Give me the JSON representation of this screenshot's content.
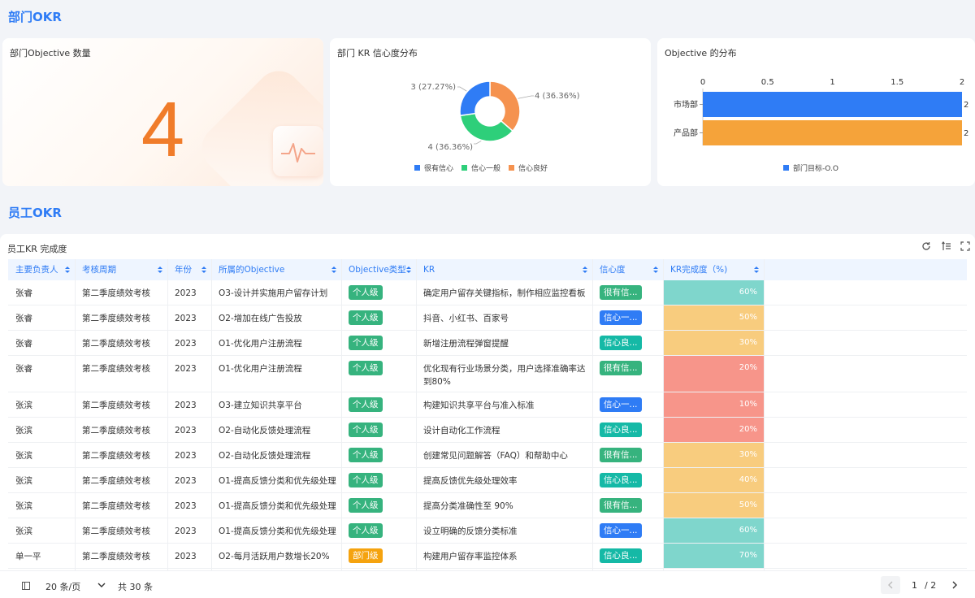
{
  "sections": {
    "dept_title": "部门OKR",
    "staff_title": "员工OKR"
  },
  "kpi": {
    "title": "部门Objective 数量",
    "value": "4"
  },
  "donut": {
    "title": "部门 KR 信心度分布",
    "chart_data": {
      "type": "pie",
      "categories": [
        "很有信心",
        "信心一般",
        "信心良好"
      ],
      "values": [
        3,
        4,
        4
      ],
      "labels": [
        "3 (27.27%)",
        "4 (36.36%)",
        "4 (36.36%)"
      ],
      "colors": [
        "#2f7cf5",
        "#2ecf7a",
        "#f5924f"
      ],
      "legend": "bottom"
    }
  },
  "hbar": {
    "title": "Objective 的分布",
    "chart_data": {
      "type": "bar",
      "orientation": "horizontal",
      "categories": [
        "市场部",
        "产品部"
      ],
      "values": [
        2,
        2
      ],
      "colors": [
        "#2f7cf5",
        "#f5a33a"
      ],
      "xlim": [
        0,
        2
      ],
      "ticks": [
        "0",
        "0.5",
        "1",
        "1.5",
        "2"
      ],
      "value_labels": [
        "2",
        "2"
      ],
      "legend_label": "部门目标-O.O",
      "legend": "bottom"
    }
  },
  "table": {
    "title": "员工KR 完成度",
    "columns": [
      "主要负责人",
      "考核周期",
      "年份",
      "所属的Objective",
      "Objective类型",
      "KR",
      "信心度",
      "KR完成度（%)"
    ],
    "rows": [
      {
        "owner": "张睿",
        "period": "第二季度绩效考核",
        "year": "2023",
        "objective": "O3-设计并实施用户留存计划",
        "type": "个人级",
        "kr": "确定用户留存关键指标，制作相应监控看板",
        "confidence": "很有信...",
        "progress": "60%"
      },
      {
        "owner": "张睿",
        "period": "第二季度绩效考核",
        "year": "2023",
        "objective": "O2-增加在线广告投放",
        "type": "个人级",
        "kr": "抖音、小红书、百家号",
        "confidence": "信心一...",
        "progress": "50%"
      },
      {
        "owner": "张睿",
        "period": "第二季度绩效考核",
        "year": "2023",
        "objective": "O1-优化用户注册流程",
        "type": "个人级",
        "kr": "新增注册流程弹窗提醒",
        "confidence": "信心良...",
        "progress": "30%"
      },
      {
        "owner": "张睿",
        "period": "第二季度绩效考核",
        "year": "2023",
        "objective": "O1-优化用户注册流程",
        "type": "个人级",
        "kr": "优化现有行业场景分类，用户选择准确率达",
        "kr2": "到80%",
        "confidence": "很有信...",
        "progress": "20%"
      },
      {
        "owner": "张滨",
        "period": "第二季度绩效考核",
        "year": "2023",
        "objective": "O3-建立知识共享平台",
        "type": "个人级",
        "kr": "构建知识共享平台与准入标准",
        "confidence": "信心一...",
        "progress": "10%"
      },
      {
        "owner": "张滨",
        "period": "第二季度绩效考核",
        "year": "2023",
        "objective": "O2-自动化反馈处理流程",
        "type": "个人级",
        "kr": "设计自动化工作流程",
        "confidence": "信心良...",
        "progress": "20%"
      },
      {
        "owner": "张滨",
        "period": "第二季度绩效考核",
        "year": "2023",
        "objective": "O2-自动化反馈处理流程",
        "type": "个人级",
        "kr": "创建常见问题解答（FAQ）和帮助中心",
        "confidence": "很有信...",
        "progress": "30%"
      },
      {
        "owner": "张滨",
        "period": "第二季度绩效考核",
        "year": "2023",
        "objective": "O1-提高反馈分类和优先级处理",
        "type": "个人级",
        "kr": "提高反馈优先级处理效率",
        "confidence": "信心良...",
        "progress": "40%"
      },
      {
        "owner": "张滨",
        "period": "第二季度绩效考核",
        "year": "2023",
        "objective": "O1-提高反馈分类和优先级处理",
        "type": "个人级",
        "kr": "提高分类准确性至 90%",
        "confidence": "很有信...",
        "progress": "50%"
      },
      {
        "owner": "张滨",
        "period": "第二季度绩效考核",
        "year": "2023",
        "objective": "O1-提高反馈分类和优先级处理",
        "type": "个人级",
        "kr": "设立明确的反馈分类标准",
        "confidence": "信心一...",
        "progress": "60%"
      },
      {
        "owner": "单一平",
        "period": "第二季度绩效考核",
        "year": "2023",
        "objective": "O2-每月活跃用户数增长20%",
        "type": "部门级",
        "kr": "构建用户留存率监控体系",
        "confidence": "信心良...",
        "progress": "70%"
      }
    ],
    "colors": {
      "type_personal": "#36b37e",
      "type_dept": "#f5a30f",
      "conf_very": "#36b37e",
      "conf_normal": "#2f7cf5",
      "conf_good": "#15b9a6",
      "bar_high": "#7fd6cc",
      "bar_mid": "#f8cc7e",
      "bar_low": "#f7958a"
    }
  },
  "pager": {
    "page_size": "20 条/页",
    "total": "共 30 条",
    "current": "1",
    "of_total": "/ 2"
  }
}
